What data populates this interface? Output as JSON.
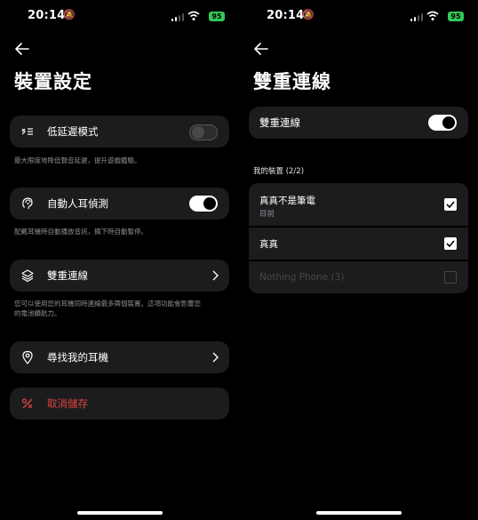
{
  "status": {
    "time": "20:14",
    "battery": "95"
  },
  "left": {
    "title": "裝置設定",
    "low_latency": {
      "label": "低延遲模式",
      "desc": "最大限度地降低聲音延遲，提升遊戲體驗。",
      "enabled": false
    },
    "ear_detect": {
      "label": "自動人耳偵測",
      "desc": "配戴耳機時自動播放音訊，摘下時自動暫停。",
      "enabled": true
    },
    "dual": {
      "label": "雙重連線",
      "desc_line1": "您可以使用您的耳機同時連線最多兩個裝置。這項功能會影響您",
      "desc_line2": "的電池續航力。"
    },
    "find": {
      "label": "尋找我的耳機"
    },
    "unpair": {
      "label": "取消儲存"
    }
  },
  "right": {
    "title": "雙重連線",
    "dual_toggle": {
      "label": "雙重連線",
      "enabled": true
    },
    "section": "我的裝置 (2/2)",
    "devices": [
      {
        "name": "真真不是筆電",
        "sub": "目前",
        "checked": true
      },
      {
        "name": "真真",
        "sub": "",
        "checked": true
      },
      {
        "name": "Nothing Phone (3)",
        "sub": "",
        "checked": false
      }
    ]
  },
  "colors": {
    "danger": "#e0443c",
    "card": "#1c1c1e",
    "battery": "#34c759"
  }
}
